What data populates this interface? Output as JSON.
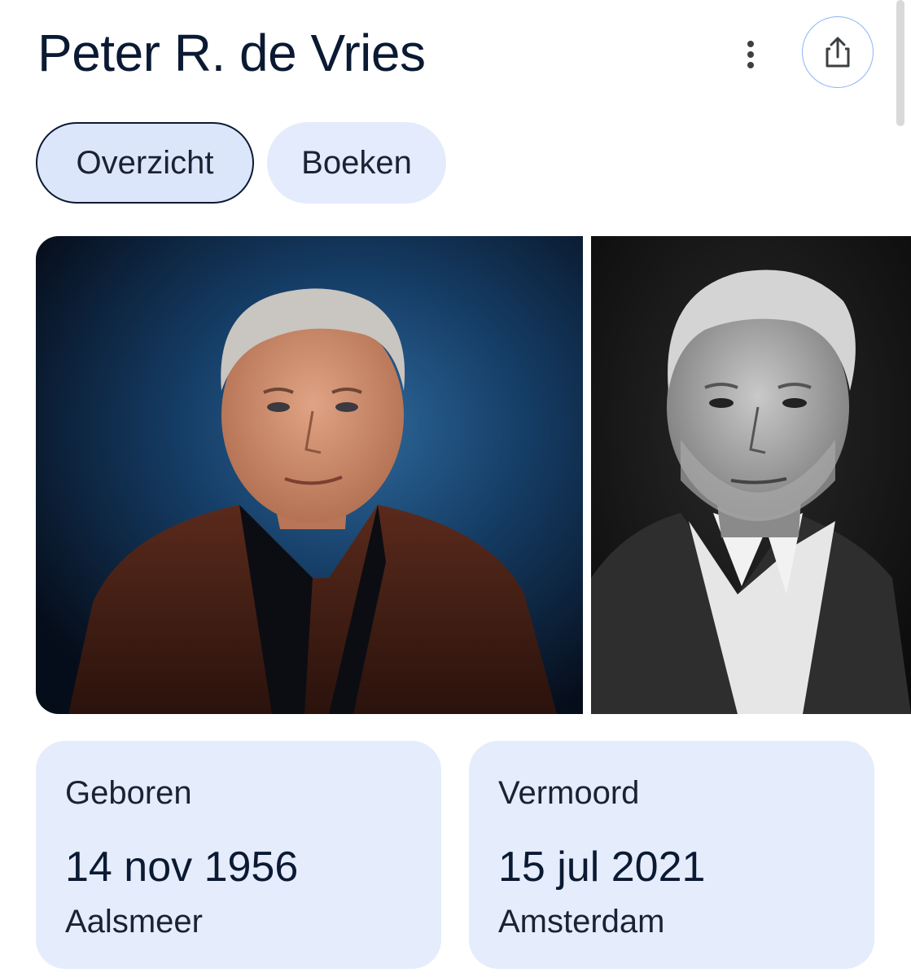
{
  "header": {
    "title": "Peter R. de Vries",
    "more_icon": "more-vert-icon",
    "share_icon": "share-icon"
  },
  "tabs": [
    {
      "label": "Overzicht",
      "selected": true
    },
    {
      "label": "Boeken",
      "selected": false
    }
  ],
  "images": [
    {
      "description_icon": "portrait-photo-color"
    },
    {
      "description_icon": "portrait-photo-bw"
    }
  ],
  "facts": [
    {
      "label": "Geboren",
      "date": "14 nov 1956",
      "place": "Aalsmeer"
    },
    {
      "label": "Vermoord",
      "date": "15 jul 2021",
      "place": "Amsterdam"
    }
  ],
  "colors": {
    "title": "#0b1a33",
    "chip_bg": "#e3ebfc",
    "card_bg": "#e5ecfb",
    "share_border": "#8ab4f8"
  }
}
